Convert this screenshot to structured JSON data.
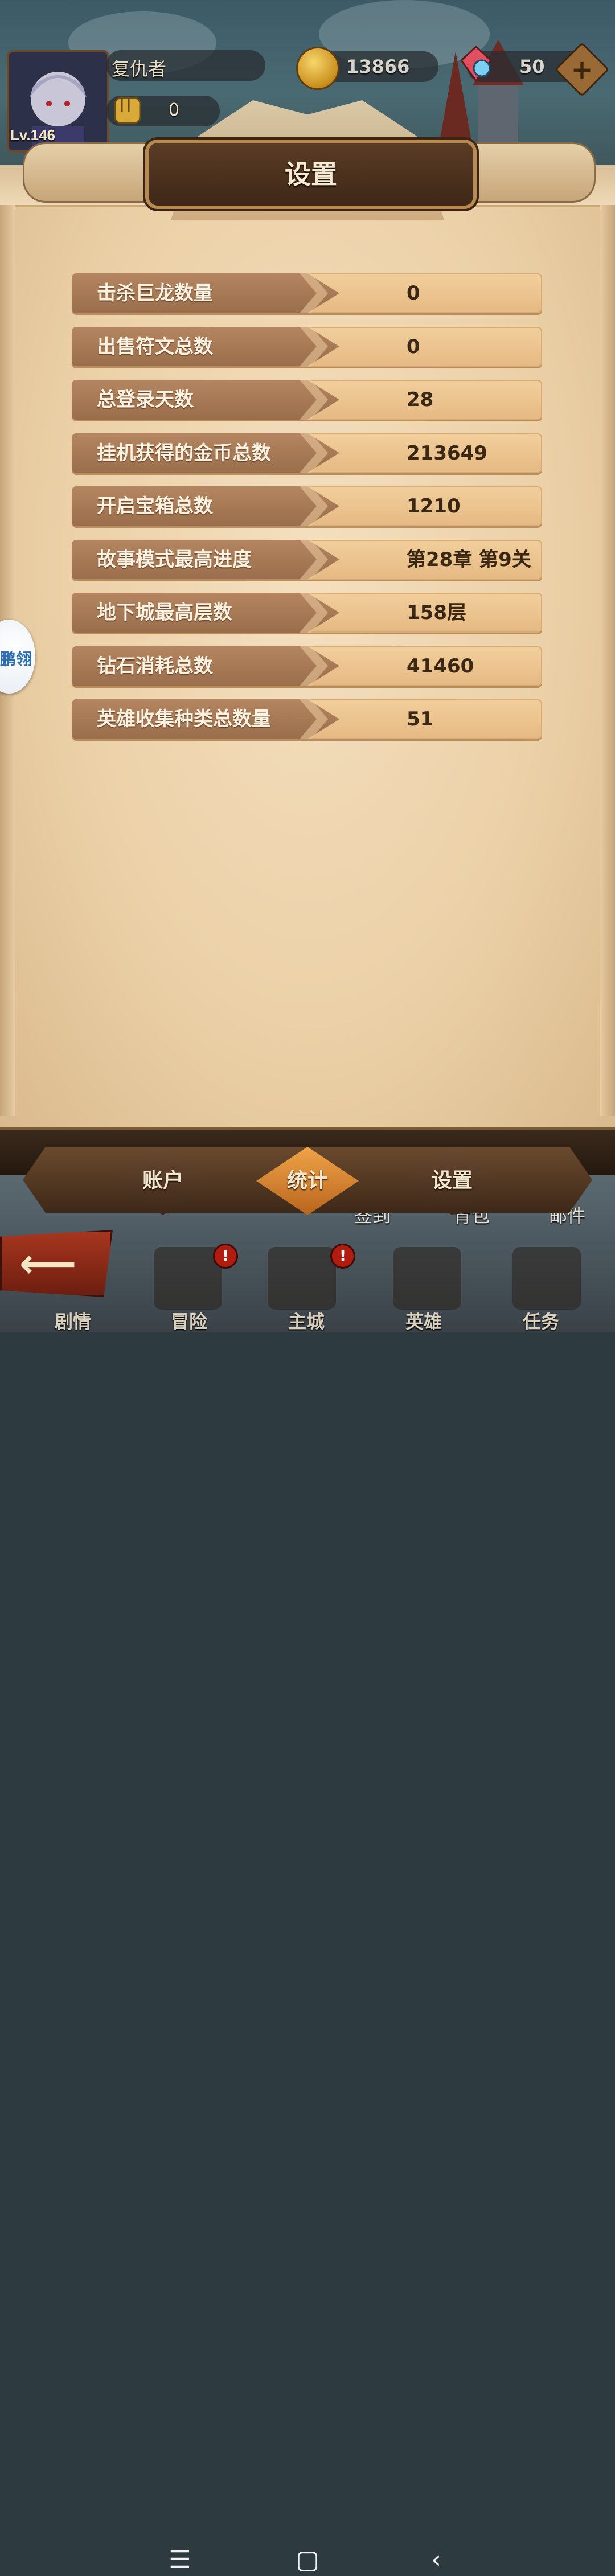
{
  "player": {
    "name": "复仇者",
    "level": "Lv.146",
    "power": "0"
  },
  "currency": {
    "coins": "13866",
    "gems": "50",
    "add_icon": "plus-icon"
  },
  "dialog": {
    "title": "设置",
    "stats": [
      {
        "label": "击杀巨龙数量",
        "value": "0"
      },
      {
        "label": "出售符文总数",
        "value": "0"
      },
      {
        "label": "总登录天数",
        "value": "28"
      },
      {
        "label": "挂机获得的金币总数",
        "value": "213649"
      },
      {
        "label": "开启宝箱总数",
        "value": "1210"
      },
      {
        "label": "故事模式最高进度",
        "value": "第28章 第9关"
      },
      {
        "label": "地下城最高层数",
        "value": "158层"
      },
      {
        "label": "钻石消耗总数",
        "value": "41460"
      },
      {
        "label": "英雄收集种类总数量",
        "value": "51"
      }
    ]
  },
  "tabs": [
    {
      "label": "账户",
      "active": false
    },
    {
      "label": "统计",
      "active": true
    },
    {
      "label": "设置",
      "active": false
    }
  ],
  "menu": {
    "top_items": [
      "签到",
      "背包",
      "邮件"
    ],
    "bottom_items": [
      "剧情",
      "冒险",
      "主城",
      "英雄",
      "任务"
    ],
    "badge": "!"
  },
  "side_widget": {
    "text": "鹏翎"
  },
  "colors": {
    "accent": "#e08a2e",
    "parchment": "#f1dab5",
    "row_label": "#a97a56"
  }
}
